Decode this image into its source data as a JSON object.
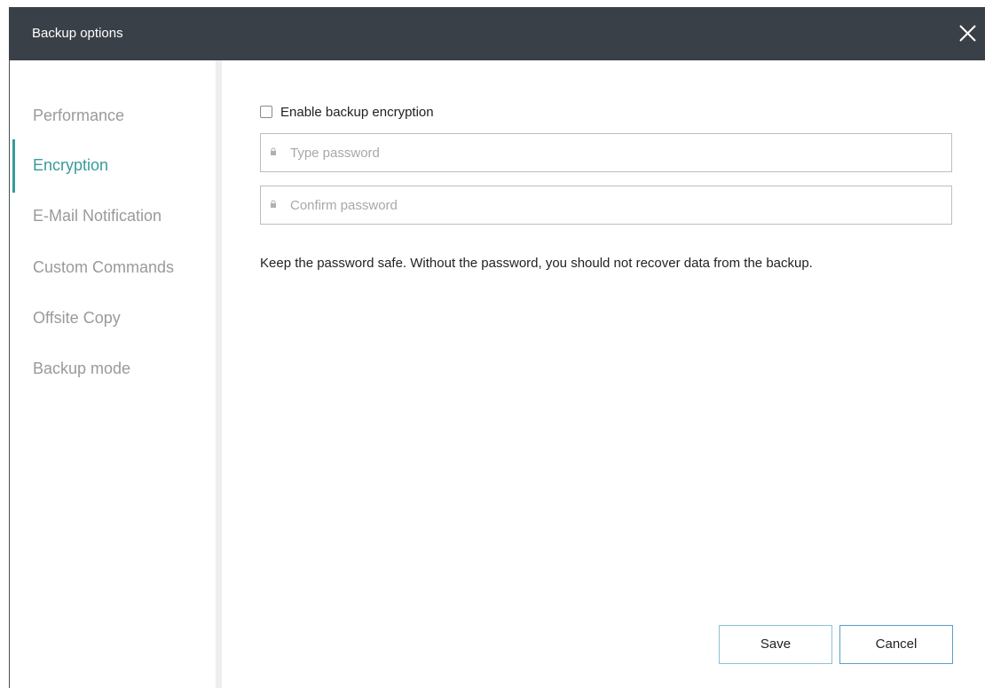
{
  "window": {
    "title": "Backup options",
    "close_icon": "close-icon"
  },
  "sidebar": {
    "items": [
      {
        "label": "Performance",
        "active": false
      },
      {
        "label": "Encryption",
        "active": true
      },
      {
        "label": "E-Mail Notification",
        "active": false
      },
      {
        "label": "Custom Commands",
        "active": false
      },
      {
        "label": "Offsite Copy",
        "active": false
      },
      {
        "label": "Backup mode",
        "active": false
      }
    ]
  },
  "encryption": {
    "enable_label": "Enable backup encryption",
    "enabled": false,
    "password": {
      "placeholder": "Type password",
      "value": "",
      "icon": "lock-icon"
    },
    "confirm": {
      "placeholder": "Confirm password",
      "value": "",
      "icon": "lock-icon"
    },
    "hint": "Keep the password safe. Without the password, you should not recover data from the backup."
  },
  "footer": {
    "save_label": "Save",
    "cancel_label": "Cancel"
  },
  "colors": {
    "titlebar": "#3a4047",
    "accent": "#3a9a9a",
    "nav_inactive": "#9a9a9a",
    "save_border": "#8fc3d3",
    "cancel_border": "#5a9fc4"
  }
}
